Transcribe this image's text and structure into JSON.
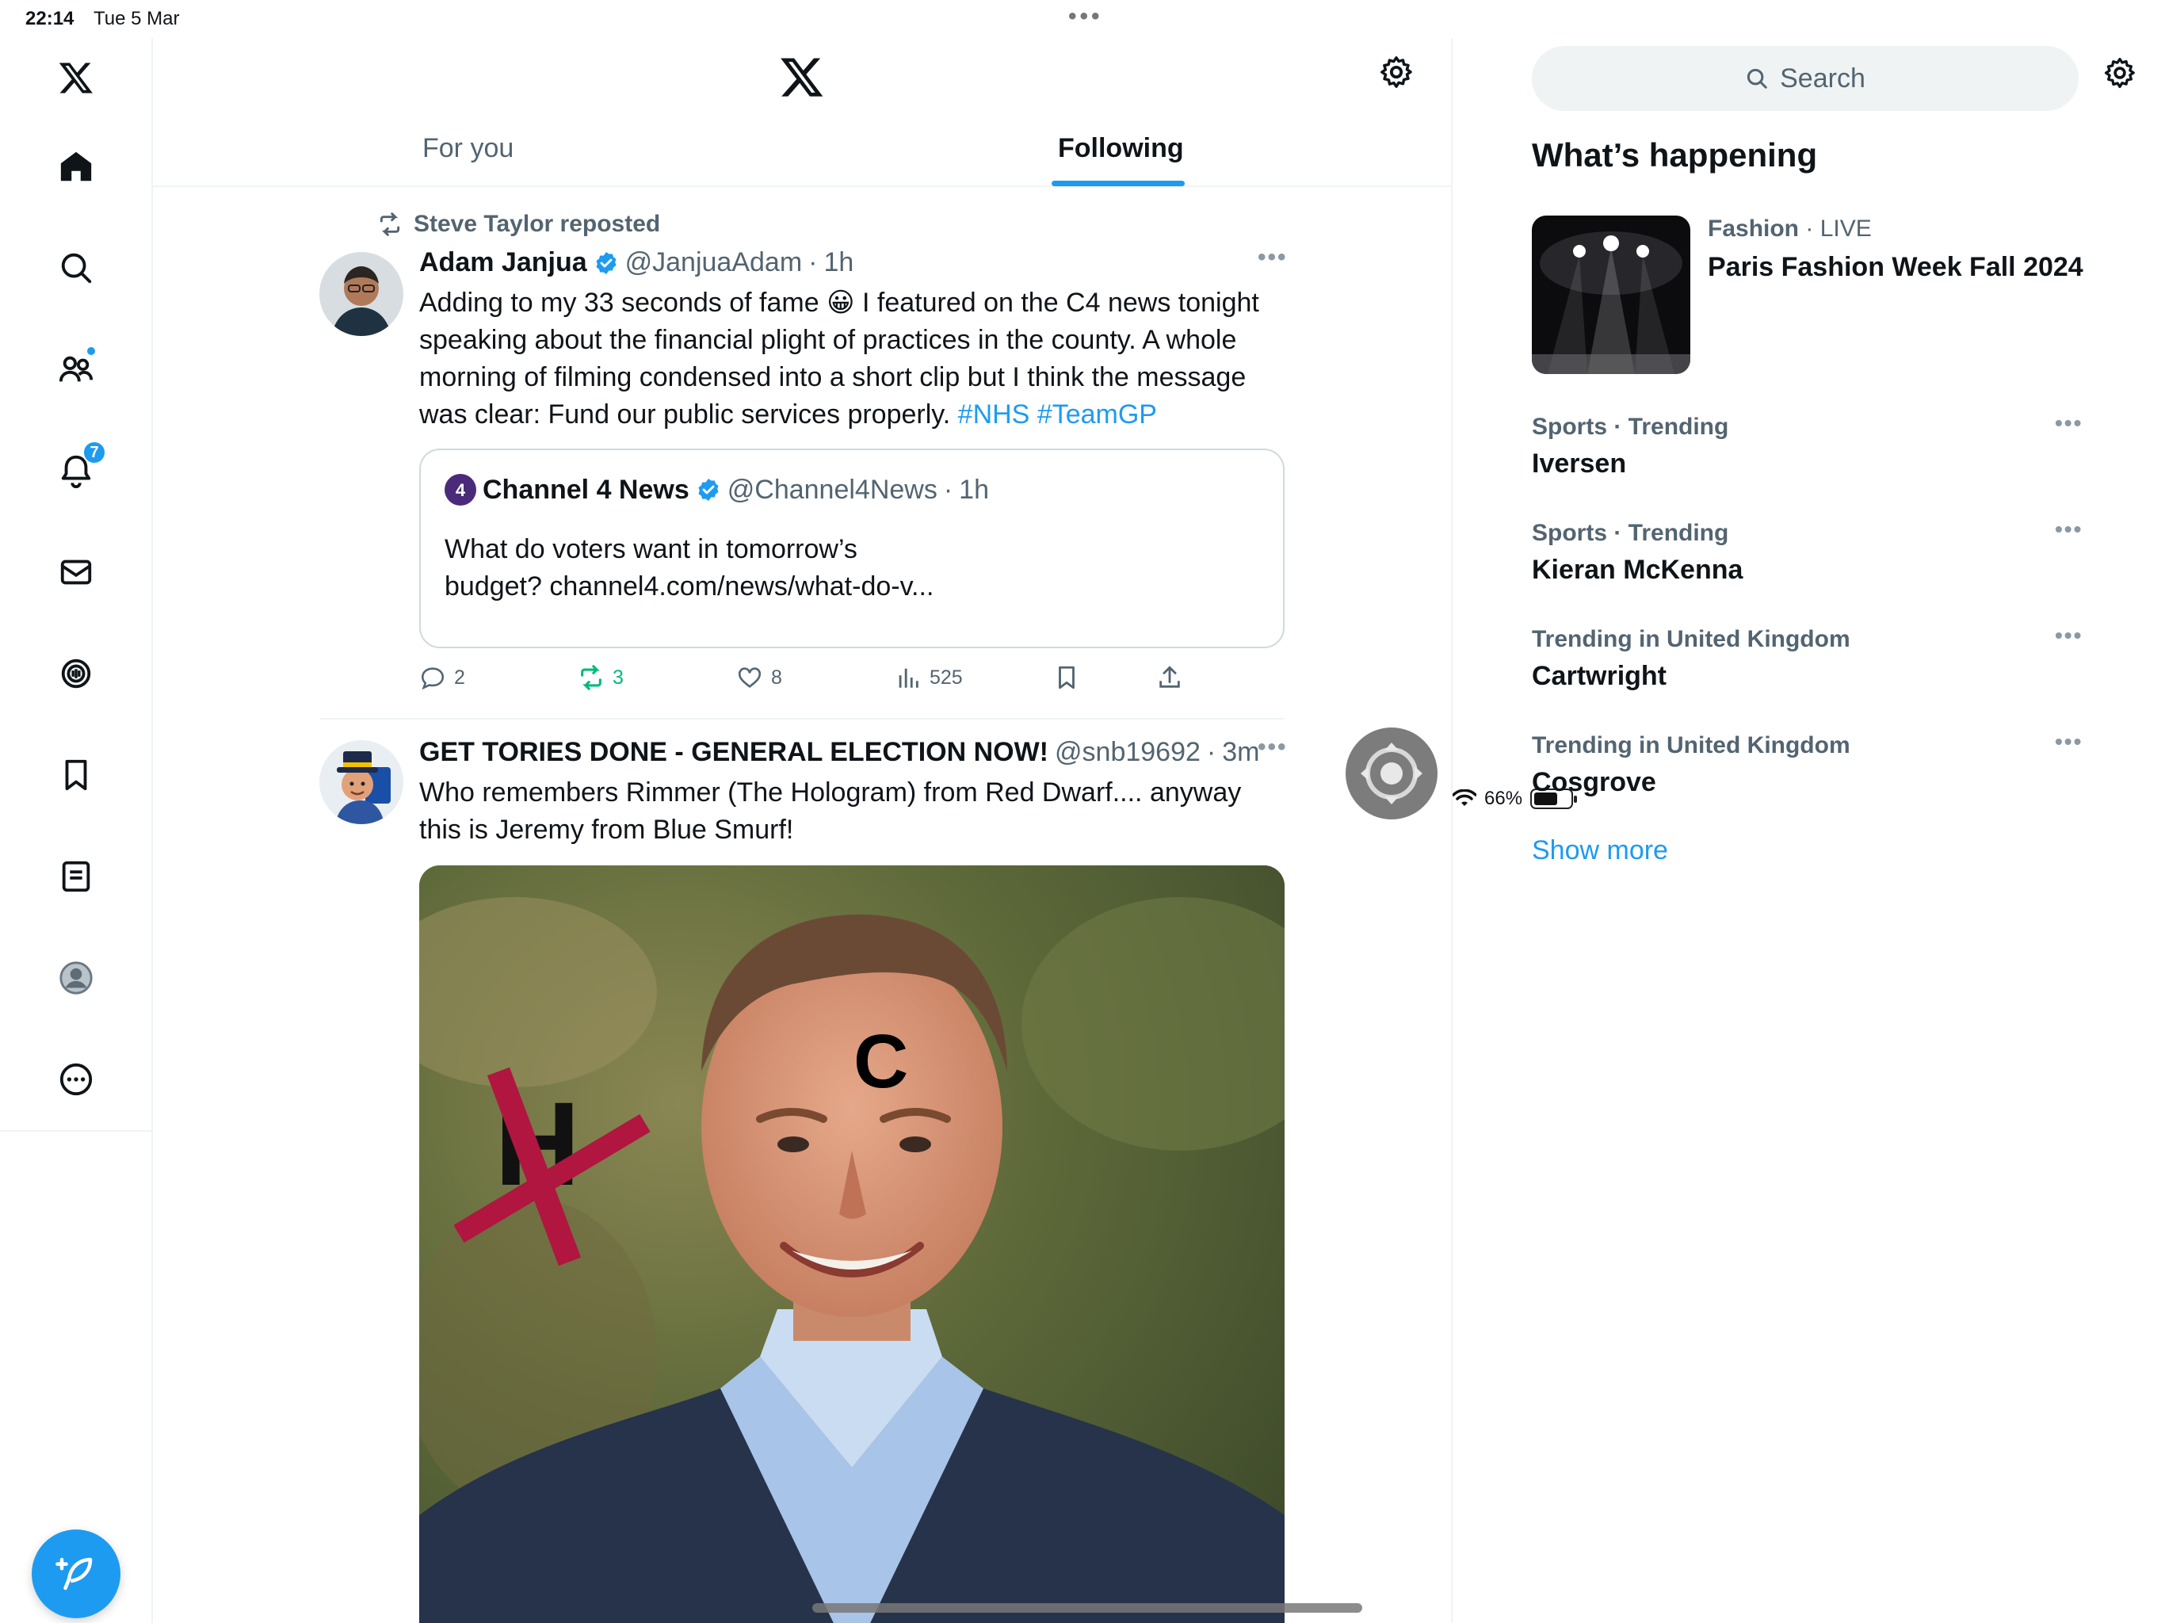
{
  "status_bar": {
    "time": "22:14",
    "date": "Tue 5 Mar",
    "battery": "66%",
    "battery_level": 0.66
  },
  "nav": {
    "items": [
      {
        "name": "home",
        "icon": "home-icon"
      },
      {
        "name": "explore",
        "icon": "search-icon"
      },
      {
        "name": "communities",
        "icon": "communities-icon",
        "dot": true
      },
      {
        "name": "notifications",
        "icon": "bell-icon",
        "badge": "7"
      },
      {
        "name": "messages",
        "icon": "envelope-icon"
      },
      {
        "name": "spaces",
        "icon": "spaces-icon"
      },
      {
        "name": "bookmarks",
        "icon": "bookmark-icon"
      },
      {
        "name": "lists",
        "icon": "list-icon"
      },
      {
        "name": "profile",
        "icon": "profile-icon"
      },
      {
        "name": "more",
        "icon": "more-circle-icon"
      }
    ],
    "compose_icon": "compose-feather-icon"
  },
  "header": {
    "tabs": [
      "For you",
      "Following"
    ],
    "active_tab": "Following"
  },
  "tweets": [
    {
      "repost_by": "Steve Taylor reposted",
      "name": "Adam Janjua",
      "handle": "@JanjuaAdam",
      "sep": "·",
      "time": "1h",
      "text_a": "Adding to my 33 seconds of fame ",
      "emoji": "😀",
      "text_b": " I featured on the C4 news tonight speaking about the financial plight of practices in the county. A whole morning of filming condensed into a short clip but I think the message was clear: Fund our public services properly. ",
      "tag1": "#NHS",
      "tag2": "#TeamGP",
      "quote": {
        "name": "Channel 4 News",
        "handle": "@Channel4News",
        "sep": "·",
        "time": "1h",
        "text": "What do voters want in tomorrow’s budget? channel4.com/news/what-do-v..."
      },
      "actions": {
        "replies": "2",
        "reposts": "3",
        "likes": "8",
        "views": "525"
      }
    },
    {
      "name": "GET TORIES DONE - GENERAL ELECTION NOW!",
      "handle": "@snb19692",
      "sep": "·",
      "time": "3m",
      "text": "Who remembers Rimmer (The Hologram) from Red Dwarf.... anyway this is Jeremy from Blue Smurf!",
      "image_letter_h": "H",
      "image_letter_c": "C"
    }
  ],
  "sidebar": {
    "search_placeholder": "Search",
    "title": "What’s happening",
    "featured": {
      "category": "Fashion",
      "sep": " · ",
      "status": "LIVE",
      "name": "Paris Fashion Week Fall 2024"
    },
    "trends": [
      {
        "meta": "Sports · Trending",
        "name": "Iversen"
      },
      {
        "meta": "Sports · Trending",
        "name": "Kieran McKenna"
      },
      {
        "meta": "Trending in United Kingdom",
        "name": "Cartwright"
      },
      {
        "meta": "Trending in United Kingdom",
        "name": "Cosgrove"
      }
    ],
    "show_more": "Show more"
  },
  "colors": {
    "accent": "#1d9bf0",
    "repost_green": "#00ba7c",
    "mark_red": "#b0163f"
  }
}
